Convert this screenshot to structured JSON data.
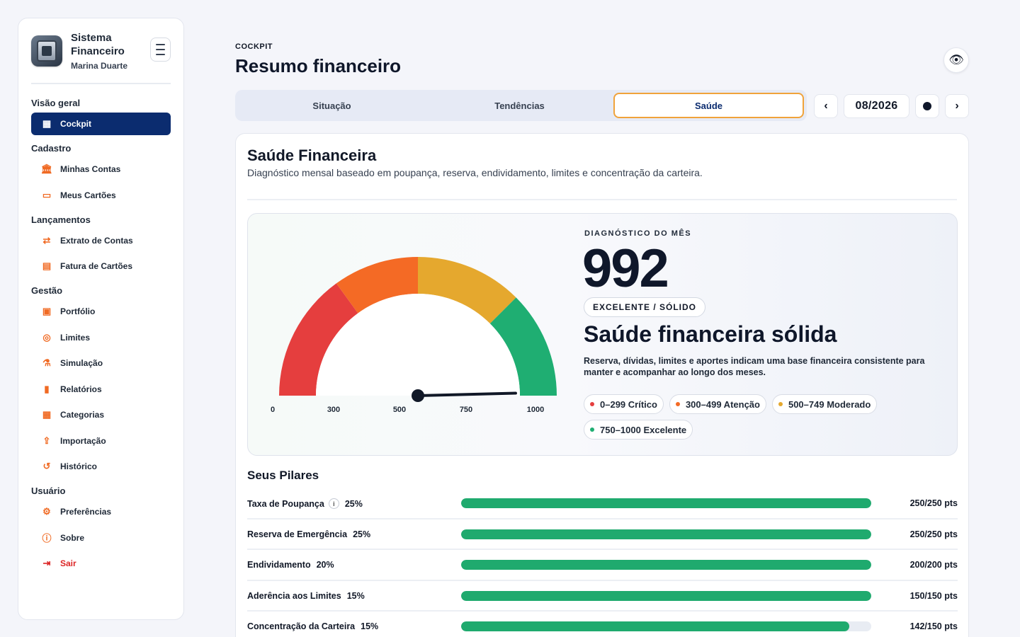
{
  "app": {
    "title": "Sistema Financeiro",
    "user": "Marina Duarte"
  },
  "sidebar": {
    "sections": [
      {
        "title": "Visão geral",
        "items": [
          {
            "label": "Cockpit",
            "icon": "grid-icon",
            "active": true
          }
        ]
      },
      {
        "title": "Cadastro",
        "items": [
          {
            "label": "Minhas Contas",
            "icon": "bank-icon"
          },
          {
            "label": "Meus Cartões",
            "icon": "card-icon"
          }
        ]
      },
      {
        "title": "Lançamentos",
        "items": [
          {
            "label": "Extrato de Contas",
            "icon": "transfer-icon"
          },
          {
            "label": "Fatura de Cartões",
            "icon": "receipt-icon"
          }
        ]
      },
      {
        "title": "Gestão",
        "items": [
          {
            "label": "Portfólio",
            "icon": "briefcase-icon"
          },
          {
            "label": "Limites",
            "icon": "target-icon"
          },
          {
            "label": "Simulação",
            "icon": "flask-icon"
          },
          {
            "label": "Relatórios",
            "icon": "bar-chart-icon"
          },
          {
            "label": "Categorias",
            "icon": "categories-icon"
          },
          {
            "label": "Importação",
            "icon": "upload-icon"
          },
          {
            "label": "Histórico",
            "icon": "history-icon"
          }
        ]
      },
      {
        "title": "Usuário",
        "items": [
          {
            "label": "Preferências",
            "icon": "gear-icon"
          },
          {
            "label": "Sobre",
            "icon": "info-icon"
          },
          {
            "label": "Sair",
            "icon": "logout-icon",
            "danger": true
          }
        ]
      }
    ]
  },
  "header": {
    "eyebrow": "COCKPIT",
    "title": "Resumo financeiro"
  },
  "tabs": [
    {
      "label": "Situação",
      "active": false
    },
    {
      "label": "Tendências",
      "active": false
    },
    {
      "label": "Saúde",
      "active": true
    }
  ],
  "period": {
    "prev": "‹",
    "label": "08/2026",
    "next": "›"
  },
  "health": {
    "title": "Saúde Financeira",
    "subtitle": "Diagnóstico mensal baseado em poupança, reserva, endividamento, limites e concentração da carteira.",
    "eyebrow": "DIAGNÓSTICO DO MÊS",
    "score": 992,
    "score_text": "992",
    "badge": "EXCELENTE / SÓLIDO",
    "headline": "Saúde financeira sólida",
    "description": "Reserva, dívidas, limites e aportes indicam uma base financeira consistente para manter e acompanhar ao longo dos meses.",
    "gauge": {
      "min": 0,
      "max": 1000,
      "ticks": [
        "0",
        "300",
        "500",
        "750",
        "1000"
      ],
      "tick_values": [
        0,
        300,
        500,
        750,
        1000
      ],
      "bands": [
        {
          "from": 0,
          "to": 299,
          "color": "#e53e3e"
        },
        {
          "from": 300,
          "to": 499,
          "color": "#f46a25"
        },
        {
          "from": 500,
          "to": 749,
          "color": "#e5a82e"
        },
        {
          "from": 750,
          "to": 1000,
          "color": "#1fae72"
        }
      ]
    },
    "legend": [
      {
        "label": "0–299 Crítico",
        "color": "#e53e3e"
      },
      {
        "label": "300–499 Atenção",
        "color": "#f46a25"
      },
      {
        "label": "500–749 Moderado",
        "color": "#e5a82e"
      },
      {
        "label": "750–1000 Excelente",
        "color": "#1fae72"
      }
    ]
  },
  "pillars": {
    "title": "Seus Pilares",
    "items": [
      {
        "name": "Taxa de Poupança",
        "weight": "25%",
        "info": true,
        "points": "250/250 pts",
        "progress": 1.0
      },
      {
        "name": "Reserva de Emergência",
        "weight": "25%",
        "info": false,
        "points": "250/250 pts",
        "progress": 1.0
      },
      {
        "name": "Endividamento",
        "weight": "20%",
        "info": false,
        "points": "200/200 pts",
        "progress": 1.0
      },
      {
        "name": "Aderência aos Limites",
        "weight": "15%",
        "info": false,
        "points": "150/150 pts",
        "progress": 1.0
      },
      {
        "name": "Concentração da Carteira",
        "weight": "15%",
        "info": false,
        "points": "142/150 pts",
        "progress": 0.947
      }
    ]
  }
}
